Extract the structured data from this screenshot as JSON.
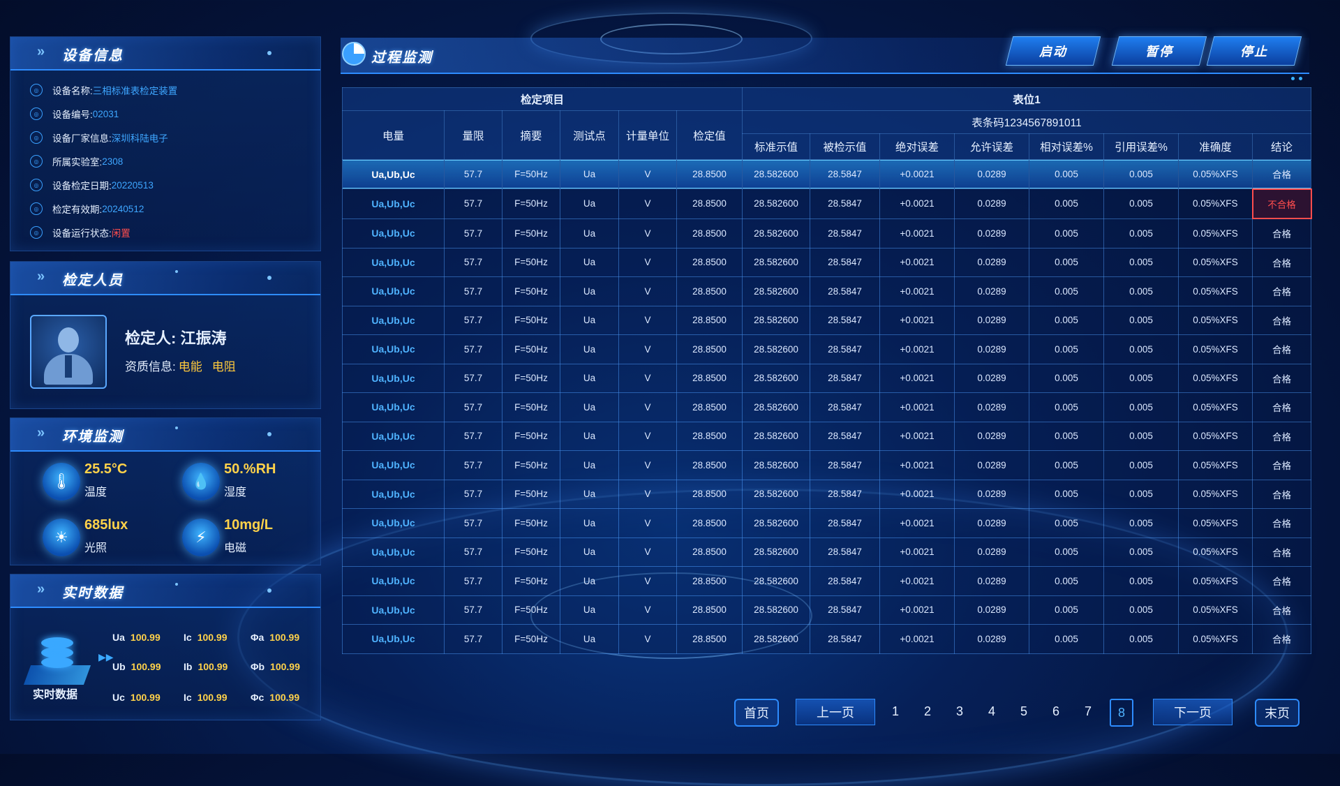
{
  "device": {
    "section_title": "设备信息",
    "rows": [
      {
        "label": "设备名称:",
        "value": "三相标准表检定装置",
        "icon": "target-icon"
      },
      {
        "label": "设备编号:",
        "value": "02031",
        "icon": "no-icon"
      },
      {
        "label": "设备厂家信息:",
        "value": "深圳科陆电子",
        "icon": "building-icon"
      },
      {
        "label": "所属实验室:",
        "value": "2308",
        "icon": "lab-icon"
      },
      {
        "label": "设备检定日期:",
        "value": "20220513",
        "icon": "calendar-icon"
      },
      {
        "label": "检定有效期:",
        "value": "20240512",
        "icon": "validity-icon"
      },
      {
        "label": "设备运行状态:",
        "value": "闲置",
        "icon": "status-icon"
      }
    ]
  },
  "inspector": {
    "section_title": "检定人员",
    "name": "检定人: 江振涛",
    "qual_label": "资质信息:",
    "qual_1": "电能",
    "qual_2": "电阻"
  },
  "environment": {
    "section_title": "环境监测",
    "items": [
      {
        "value": "25.5°C",
        "name": "温度",
        "icon": "thermometer-icon"
      },
      {
        "value": "50.%RH",
        "name": "湿度",
        "icon": "humidity-icon"
      },
      {
        "value": "685lux",
        "name": "光照",
        "icon": "sun-icon"
      },
      {
        "value": "10mg/L",
        "name": "电磁",
        "icon": "electromagnetic-icon"
      }
    ]
  },
  "realtime": {
    "section_title": "实时数据",
    "icon_label": "实时数据",
    "rows": [
      [
        {
          "k": "Ua",
          "v": "100.99"
        },
        {
          "k": "Ic",
          "v": "100.99"
        },
        {
          "k": "Φa",
          "v": "100.99"
        }
      ],
      [
        {
          "k": "Ub",
          "v": "100.99"
        },
        {
          "k": "Ib",
          "v": "100.99"
        },
        {
          "k": "Φb",
          "v": "100.99"
        }
      ],
      [
        {
          "k": "Uc",
          "v": "100.99"
        },
        {
          "k": "Ic",
          "v": "100.99"
        },
        {
          "k": "Φc",
          "v": "100.99"
        }
      ]
    ]
  },
  "main": {
    "title": "过程监测",
    "buttons": {
      "start": "启动",
      "pause": "暂停",
      "stop": "停止"
    }
  },
  "table": {
    "group_left": "检定项目",
    "group_right": "表位1",
    "barcode": "表条码1234567891011",
    "headers_left": [
      "电量",
      "量限",
      "摘要",
      "测试点",
      "计量单位",
      "检定值"
    ],
    "headers_right": [
      "标准示值",
      "被检示值",
      "绝对误差",
      "允许误差",
      "相对误差%",
      "引用误差%",
      "准确度",
      "结论"
    ],
    "rows": [
      [
        "Ua,Ub,Uc",
        "57.7",
        "F=50Hz",
        "Ua",
        "V",
        "28.8500",
        "28.582600",
        "28.5847",
        "+0.0021",
        "0.0289",
        "0.005",
        "0.005",
        "0.05%XFS",
        "合格"
      ],
      [
        "Ua,Ub,Uc",
        "57.7",
        "F=50Hz",
        "Ua",
        "V",
        "28.8500",
        "28.582600",
        "28.5847",
        "+0.0021",
        "0.0289",
        "0.005",
        "0.005",
        "0.05%XFS",
        "不合格"
      ],
      [
        "Ua,Ub,Uc",
        "57.7",
        "F=50Hz",
        "Ua",
        "V",
        "28.8500",
        "28.582600",
        "28.5847",
        "+0.0021",
        "0.0289",
        "0.005",
        "0.005",
        "0.05%XFS",
        "合格"
      ],
      [
        "Ua,Ub,Uc",
        "57.7",
        "F=50Hz",
        "Ua",
        "V",
        "28.8500",
        "28.582600",
        "28.5847",
        "+0.0021",
        "0.0289",
        "0.005",
        "0.005",
        "0.05%XFS",
        "合格"
      ],
      [
        "Ua,Ub,Uc",
        "57.7",
        "F=50Hz",
        "Ua",
        "V",
        "28.8500",
        "28.582600",
        "28.5847",
        "+0.0021",
        "0.0289",
        "0.005",
        "0.005",
        "0.05%XFS",
        "合格"
      ],
      [
        "Ua,Ub,Uc",
        "57.7",
        "F=50Hz",
        "Ua",
        "V",
        "28.8500",
        "28.582600",
        "28.5847",
        "+0.0021",
        "0.0289",
        "0.005",
        "0.005",
        "0.05%XFS",
        "合格"
      ],
      [
        "Ua,Ub,Uc",
        "57.7",
        "F=50Hz",
        "Ua",
        "V",
        "28.8500",
        "28.582600",
        "28.5847",
        "+0.0021",
        "0.0289",
        "0.005",
        "0.005",
        "0.05%XFS",
        "合格"
      ],
      [
        "Ua,Ub,Uc",
        "57.7",
        "F=50Hz",
        "Ua",
        "V",
        "28.8500",
        "28.582600",
        "28.5847",
        "+0.0021",
        "0.0289",
        "0.005",
        "0.005",
        "0.05%XFS",
        "合格"
      ],
      [
        "Ua,Ub,Uc",
        "57.7",
        "F=50Hz",
        "Ua",
        "V",
        "28.8500",
        "28.582600",
        "28.5847",
        "+0.0021",
        "0.0289",
        "0.005",
        "0.005",
        "0.05%XFS",
        "合格"
      ],
      [
        "Ua,Ub,Uc",
        "57.7",
        "F=50Hz",
        "Ua",
        "V",
        "28.8500",
        "28.582600",
        "28.5847",
        "+0.0021",
        "0.0289",
        "0.005",
        "0.005",
        "0.05%XFS",
        "合格"
      ],
      [
        "Ua,Ub,Uc",
        "57.7",
        "F=50Hz",
        "Ua",
        "V",
        "28.8500",
        "28.582600",
        "28.5847",
        "+0.0021",
        "0.0289",
        "0.005",
        "0.005",
        "0.05%XFS",
        "合格"
      ],
      [
        "Ua,Ub,Uc",
        "57.7",
        "F=50Hz",
        "Ua",
        "V",
        "28.8500",
        "28.582600",
        "28.5847",
        "+0.0021",
        "0.0289",
        "0.005",
        "0.005",
        "0.05%XFS",
        "合格"
      ],
      [
        "Ua,Ub,Uc",
        "57.7",
        "F=50Hz",
        "Ua",
        "V",
        "28.8500",
        "28.582600",
        "28.5847",
        "+0.0021",
        "0.0289",
        "0.005",
        "0.005",
        "0.05%XFS",
        "合格"
      ],
      [
        "Ua,Ub,Uc",
        "57.7",
        "F=50Hz",
        "Ua",
        "V",
        "28.8500",
        "28.582600",
        "28.5847",
        "+0.0021",
        "0.0289",
        "0.005",
        "0.005",
        "0.05%XFS",
        "合格"
      ],
      [
        "Ua,Ub,Uc",
        "57.7",
        "F=50Hz",
        "Ua",
        "V",
        "28.8500",
        "28.582600",
        "28.5847",
        "+0.0021",
        "0.0289",
        "0.005",
        "0.005",
        "0.05%XFS",
        "合格"
      ],
      [
        "Ua,Ub,Uc",
        "57.7",
        "F=50Hz",
        "Ua",
        "V",
        "28.8500",
        "28.582600",
        "28.5847",
        "+0.0021",
        "0.0289",
        "0.005",
        "0.005",
        "0.05%XFS",
        "合格"
      ],
      [
        "Ua,Ub,Uc",
        "57.7",
        "F=50Hz",
        "Ua",
        "V",
        "28.8500",
        "28.582600",
        "28.5847",
        "+0.0021",
        "0.0289",
        "0.005",
        "0.005",
        "0.05%XFS",
        "合格"
      ]
    ],
    "selected_row": 0,
    "fail_value": "不合格"
  },
  "pagination": {
    "first": "首页",
    "prev": "上一页",
    "pages": [
      "1",
      "2",
      "3",
      "4",
      "5",
      "6",
      "7",
      "8"
    ],
    "current": "8",
    "next": "下一页",
    "last": "末页"
  },
  "colors": {
    "accent": "#2e8cff",
    "value_blue": "#3ea6ff",
    "value_yellow": "#ffd24a",
    "fail_red": "#ff4d4d",
    "background": "#04143c"
  }
}
